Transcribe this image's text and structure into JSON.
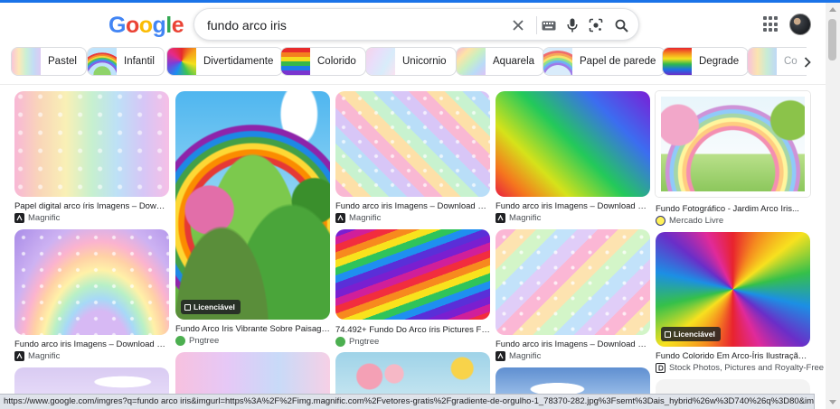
{
  "logo": {
    "letters": [
      "G",
      "o",
      "o",
      "g",
      "l",
      "e"
    ],
    "colors": [
      "#4285f4",
      "#ea4335",
      "#fbbc05",
      "#4285f4",
      "#34a853",
      "#ea4335"
    ]
  },
  "search": {
    "query": "fundo arco iris"
  },
  "icons": {
    "clear": "close-icon",
    "keyboard": "keyboard-icon",
    "mic": "microphone-icon",
    "lens": "camera-lens-icon",
    "search": "search-icon",
    "apps": "apps-grid-icon",
    "next": "chevron-right-icon"
  },
  "chips": [
    {
      "label": "Pastel"
    },
    {
      "label": "Infantil"
    },
    {
      "label": "Divertidamente"
    },
    {
      "label": "Colorido"
    },
    {
      "label": "Unicornio"
    },
    {
      "label": "Aquarela"
    },
    {
      "label": "Papel de parede"
    },
    {
      "label": "Degrade"
    },
    {
      "label": "Co"
    }
  ],
  "results": [
    {
      "title": "Papel digital arco íris Imagens – Downloa...",
      "source": "Magnific"
    },
    {
      "title": "Fundo Arco Iris Vibrante Sobre Paisagem...",
      "source": "Pngtree",
      "badge": "Licenciável"
    },
    {
      "title": "Fundo arco iris Imagens – Download Grát...",
      "source": "Magnific"
    },
    {
      "title": "Fundo arco iris Imagens – Download Grát...",
      "source": "Magnific"
    },
    {
      "title": "Fundo Fotográfico - Jardim Arco Iris...",
      "source": "Mercado Livre"
    },
    {
      "title": "Fundo arco iris Imagens – Download Grát...",
      "source": "Magnific"
    },
    {
      "title": "74.492+ Fundo Do Arco íris Pictures Foto...",
      "source": "Pngtree"
    },
    {
      "title": "Fundo arco iris Imagens – Download Grát...",
      "source": "Magnific"
    },
    {
      "title": "Fundo Colorido Em Arco-Íris Ilustração do...",
      "source": "Stock Photos, Pictures and Royalty-Free",
      "badge": "Licenciável"
    }
  ],
  "status_url": "https://www.google.com/imgres?q=fundo arco iris&imgurl=https%3A%2F%2Fimg.magnific.com%2Fvetores-gratis%2Fgradiente-de-orgulho-1_78370-282.jpg%3Fsemt%3Dais_hybrid%26w%3D740%26q%3D80&imgrefurl=https%3A%2F%2Fwww.ma..."
}
